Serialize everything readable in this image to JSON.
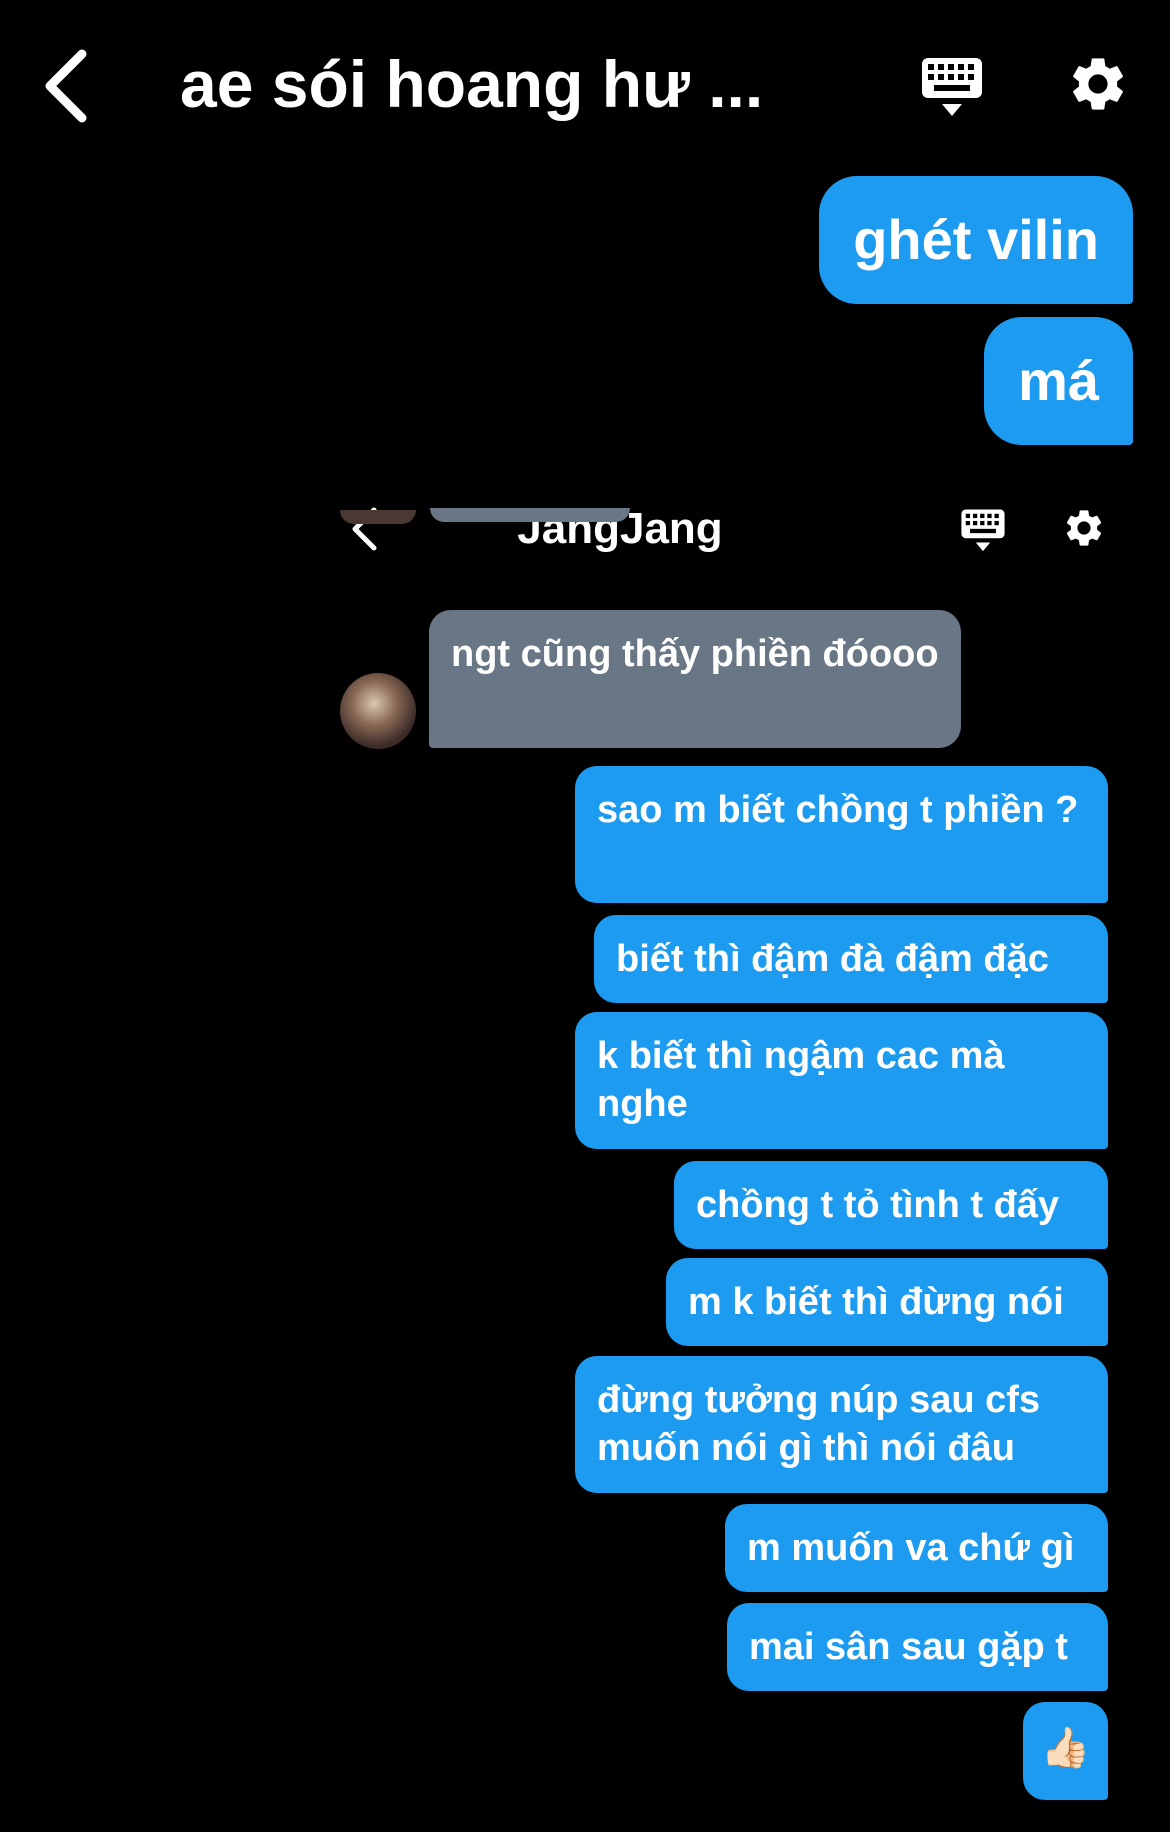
{
  "outer": {
    "title": "ae sói hoang hư ...",
    "icons": {
      "back": "chevron-left-icon",
      "keyboard": "keyboard-icon",
      "settings": "gear-icon"
    },
    "messages": [
      "ghét vilin",
      "má"
    ]
  },
  "inner": {
    "title": "JangJang",
    "icons": {
      "back": "chevron-left-icon",
      "keyboard": "keyboard-icon",
      "settings": "gear-icon",
      "avatar": "avatar"
    },
    "incoming": "ngt cũng thấy phiền đóooo",
    "outgoing": [
      "sao m biết chồng t phiền ?",
      "biết thì đậm đà đậm đặc",
      "k biết thì ngậm cac mà nghe",
      "chồng t tỏ tình t đấy",
      "m k biết thì đừng nói",
      "đừng tưởng núp sau cfs muốn nói gì thì nói đâu",
      "m muốn va chứ gì",
      "mai sân sau gặp t",
      "👍🏻"
    ]
  },
  "colors": {
    "background": "#000000",
    "bubble_out": "#1d9bf0",
    "bubble_in": "#687685",
    "text": "#ffffff"
  }
}
